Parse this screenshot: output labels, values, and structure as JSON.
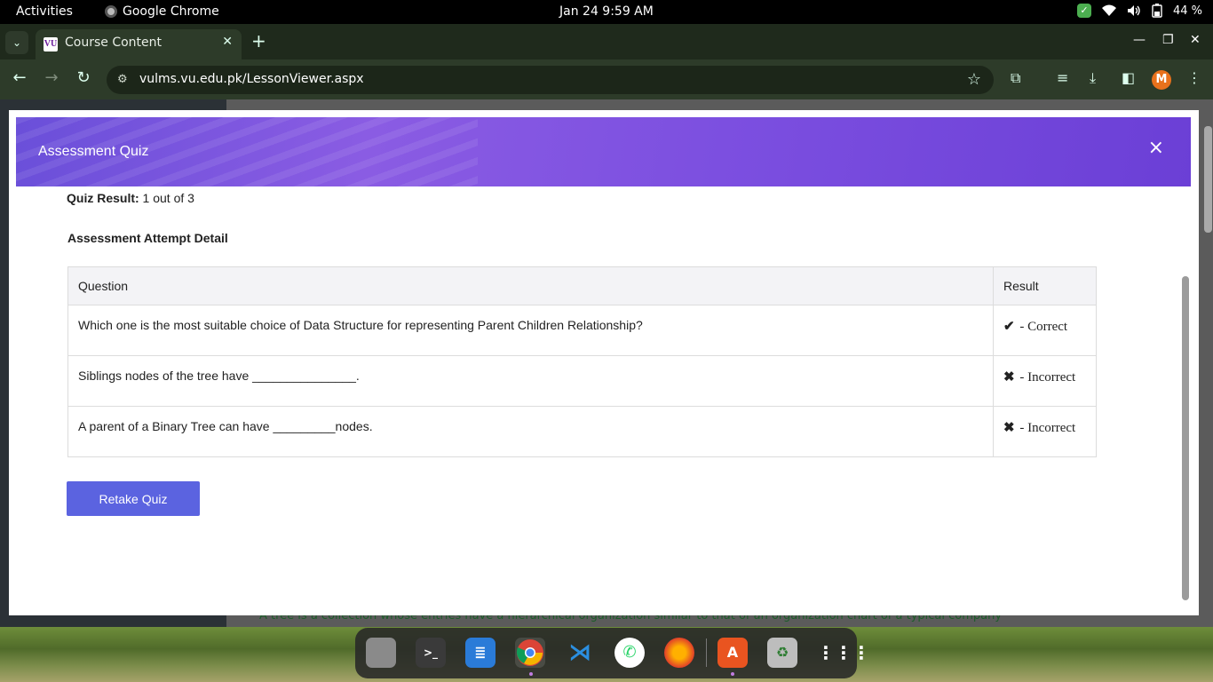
{
  "topbar": {
    "activities": "Activities",
    "app_name": "Google Chrome",
    "clock": "Jan 24   9:59 AM",
    "battery": "44 %"
  },
  "browser": {
    "tab_title": "Course Content",
    "favicon_text": "VU",
    "url": "vulms.vu.edu.pk/LessonViewer.aspx",
    "profile_initial": "M"
  },
  "modal": {
    "title": "Assessment Quiz",
    "close_symbol": "×",
    "result_label": "Quiz Result:",
    "result_value": " 1 out of 3",
    "detail_heading": "Assessment Attempt Detail",
    "table_headers": {
      "question": "Question",
      "result": "Result"
    },
    "rows": [
      {
        "question": "Which one is the most suitable choice of Data Structure for representing Parent Children Relationship?",
        "mark": "✔",
        "result": " - Correct",
        "status": "correct"
      },
      {
        "question": "Siblings nodes of the tree have _______________.",
        "mark": "✖",
        "result": " - Incorrect",
        "status": "incorrect"
      },
      {
        "question": "A parent of a Binary Tree can have _________nodes.",
        "mark": "✖",
        "result": " - Incorrect",
        "status": "incorrect"
      }
    ],
    "retake_label": "Retake Quiz"
  },
  "background_page": {
    "peek_text": "A tree is a collection whose entries have a hierarchical organization similar to that of an organization chart of a typical company"
  },
  "colors": {
    "header_accent": "#7c4fe0",
    "button": "#5b63e0",
    "correct": "#2bbb9b",
    "incorrect": "#e04c5e"
  },
  "dock": {
    "apps": [
      "files-icon",
      "terminal-icon",
      "text-editor-icon",
      "chrome-icon",
      "vscode-icon",
      "whatsapp-icon",
      "firefox-icon",
      "app-center-icon",
      "trash-icon",
      "app-grid-icon"
    ]
  }
}
